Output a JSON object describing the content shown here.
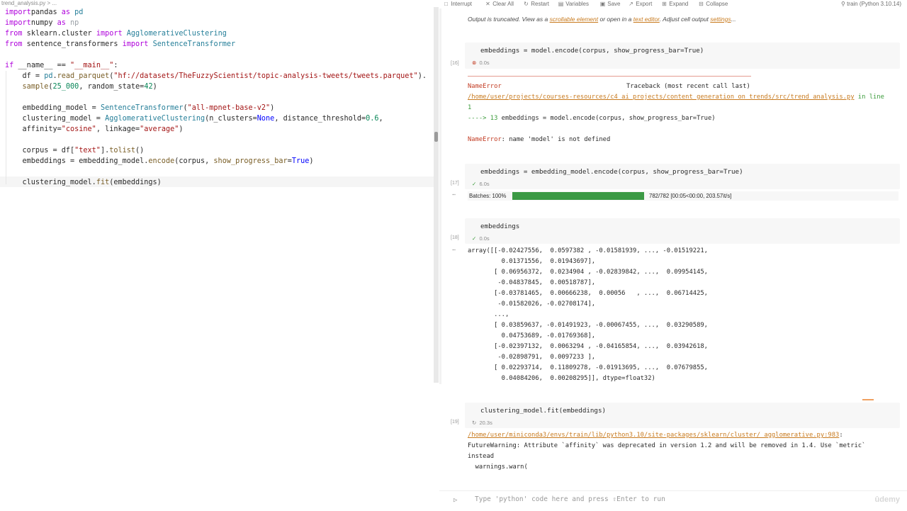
{
  "editor": {
    "tab_title": "trend_analysis.py > ...",
    "lines": [
      {
        "parts": [
          [
            "kw",
            "import"
          ],
          [
            "",
            "pandas "
          ],
          [
            "kw",
            "as"
          ],
          [
            "cls",
            " pd"
          ]
        ]
      },
      {
        "parts": [
          [
            "kw",
            "import"
          ],
          [
            "",
            "numpy "
          ],
          [
            "kw",
            "as"
          ],
          [
            "dim",
            " np"
          ]
        ]
      },
      {
        "parts": [
          [
            "kw",
            "from"
          ],
          [
            "",
            " sklearn.cluster "
          ],
          [
            "kw",
            "import"
          ],
          [
            "cls",
            " AgglomerativeClustering"
          ]
        ]
      },
      {
        "parts": [
          [
            "kw",
            "from"
          ],
          [
            "",
            " sentence_transformers "
          ],
          [
            "kw",
            "import"
          ],
          [
            "cls",
            " SentenceTransformer"
          ]
        ]
      },
      {
        "parts": []
      },
      {
        "parts": [
          [
            "kw",
            "if"
          ],
          [
            "",
            " __name__ == "
          ],
          [
            "str",
            "\"__main__\""
          ],
          [
            "",
            ":"
          ]
        ]
      },
      {
        "parts": [
          [
            "",
            "    df = "
          ],
          [
            "cls",
            "pd"
          ],
          [
            "",
            "."
          ],
          [
            "fn",
            "read_parquet"
          ],
          [
            "",
            "("
          ],
          [
            "str",
            "\"hf://datasets/TheFuzzyScientist/topic-analysis-tweets/tweets.parquet\""
          ],
          [
            "",
            ")."
          ]
        ]
      },
      {
        "parts": [
          [
            "",
            "    "
          ],
          [
            "fn",
            "sample"
          ],
          [
            "",
            "("
          ],
          [
            "num",
            "25_000"
          ],
          [
            "",
            ", random_state="
          ],
          [
            "num",
            "42"
          ],
          [
            "",
            ")"
          ]
        ]
      },
      {
        "parts": []
      },
      {
        "parts": [
          [
            "",
            "    embedding_model = "
          ],
          [
            "cls",
            "SentenceTransformer"
          ],
          [
            "",
            "("
          ],
          [
            "str",
            "\"all-mpnet-base-v2\""
          ],
          [
            "",
            ")"
          ]
        ]
      },
      {
        "parts": [
          [
            "",
            "    clustering_model = "
          ],
          [
            "cls",
            "AgglomerativeClustering"
          ],
          [
            "",
            "(n_clusters="
          ],
          [
            "kw2",
            "None"
          ],
          [
            "",
            ", distance_threshold="
          ],
          [
            "num",
            "0.6"
          ],
          [
            "",
            ","
          ]
        ]
      },
      {
        "parts": [
          [
            "",
            "    affinity="
          ],
          [
            "str",
            "\"cosine\""
          ],
          [
            "",
            ", linkage="
          ],
          [
            "str",
            "\"average\""
          ],
          [
            "",
            ")"
          ]
        ]
      },
      {
        "parts": []
      },
      {
        "parts": [
          [
            "",
            "    corpus = df["
          ],
          [
            "str",
            "\"text\""
          ],
          [
            "",
            "]."
          ],
          [
            "fn",
            "tolist"
          ],
          [
            "",
            "()"
          ]
        ]
      },
      {
        "parts": [
          [
            "",
            "    embeddings = embedding_model."
          ],
          [
            "fn",
            "encode"
          ],
          [
            "",
            "(corpus, "
          ],
          [
            "fn",
            "show_progress_bar"
          ],
          [
            "",
            "="
          ],
          [
            "kw2",
            "True"
          ],
          [
            "",
            ")"
          ]
        ]
      },
      {
        "parts": []
      },
      {
        "parts": [
          [
            "",
            "    clustering_model."
          ],
          [
            "fn",
            "fit"
          ],
          [
            "",
            "(embeddings)"
          ]
        ]
      }
    ]
  },
  "toolbar": {
    "items": [
      {
        "icon": "□",
        "label": "Interrupt",
        "name": "interrupt-button"
      },
      {
        "icon": "✕",
        "label": "Clear All",
        "name": "clear-all-button"
      },
      {
        "icon": "↻",
        "label": "Restart",
        "name": "restart-button"
      },
      {
        "icon": "▤",
        "label": "Variables",
        "name": "variables-button"
      },
      {
        "icon": "▣",
        "label": "Save",
        "name": "save-button"
      },
      {
        "icon": "↗",
        "label": "Export",
        "name": "export-button"
      },
      {
        "icon": "⊞",
        "label": "Expand",
        "name": "expand-button"
      },
      {
        "icon": "⊟",
        "label": "Collapse",
        "name": "collapse-button"
      }
    ],
    "kernel": "train (Python 3.10.14)"
  },
  "truncation": {
    "prefix": "Output is truncated. View as a ",
    "link1": "scrollable element",
    "middle": " or open in a ",
    "link2": "text editor",
    "middle2": ". Adjust cell output ",
    "link3": "settings",
    "suffix": "..."
  },
  "cells": {
    "c16": {
      "count": "[16]",
      "source": "embeddings = model.encode(corpus, show_progress_bar=True)",
      "status_icon": "⊗",
      "time": "0.0s",
      "err_name": "NameError",
      "traceback": "Traceback (most recent call last)",
      "err_path": "/home/user/projects/courses-resources/c4_ai_projects/content_generation_on_trends/src/trend_analysis.py",
      "err_in_line": " in line",
      "err_line_num": "1",
      "err_arrow": "----> 13 ",
      "err_arrow_code": "embeddings = model.encode(corpus, show_progress_bar=True)",
      "err_msg_name": "NameError",
      "err_msg": ": name 'model' is not defined"
    },
    "c17": {
      "count": "[17]",
      "source": "embeddings = embedding_model.encode(corpus, show_progress_bar=True)",
      "status_icon": "✓",
      "time": "6.0s",
      "batches_label": "Batches:  100%",
      "progress": 1.0,
      "stats": "782/782  [00:05<00:00,  203.57it/s]"
    },
    "c18": {
      "count": "[18]",
      "source": "embeddings",
      "status_icon": "✓",
      "time": "0.0s",
      "output": [
        "array([[-0.02427556,  0.0597382 , -0.01581939, ..., -0.01519221,",
        "         0.01371556,  0.01943697],",
        "       [ 0.06956372,  0.0234904 , -0.02839842, ...,  0.09954145,",
        "        -0.04837845,  0.00518787],",
        "       [-0.03781465,  0.00666238,  0.00056   , ...,  0.06714425,",
        "        -0.01582026, -0.02708174],",
        "       ...,",
        "       [ 0.03859637, -0.01491923, -0.00067455, ...,  0.03290589,",
        "         0.04753689, -0.01769368],",
        "       [-0.02397132,  0.0063294 , -0.04165854, ...,  0.03942618,",
        "        -0.02898791,  0.0097233 ],",
        "       [ 0.02293714,  0.11809278, -0.01913695, ...,  0.07679855,",
        "         0.04084206,  0.00208295]], dtype=float32)"
      ]
    },
    "c19": {
      "count": "[19]",
      "source": "clustering_model.fit(embeddings)",
      "status_icon": "↻",
      "time": "20.3s",
      "warn_path": "/home/user/miniconda3/envs/train/lib/python3.10/site-packages/sklearn/cluster/_agglomerative.py:983",
      "warn_colon": ":",
      "warn_line1": "FutureWarning: Attribute `affinity` was deprecated in version 1.2 and will be removed in 1.4. Use `metric`",
      "warn_line2": "instead",
      "warn_line3": "  warnings.warn("
    }
  },
  "input": {
    "placeholder": "Type 'python' code here and press ⇧Enter to run",
    "run_icon": "▷",
    "watermark": "ûdemy"
  },
  "colors": {
    "accent": "#c87a1e",
    "error": "#c23b22",
    "progress": "#3c9a45"
  }
}
